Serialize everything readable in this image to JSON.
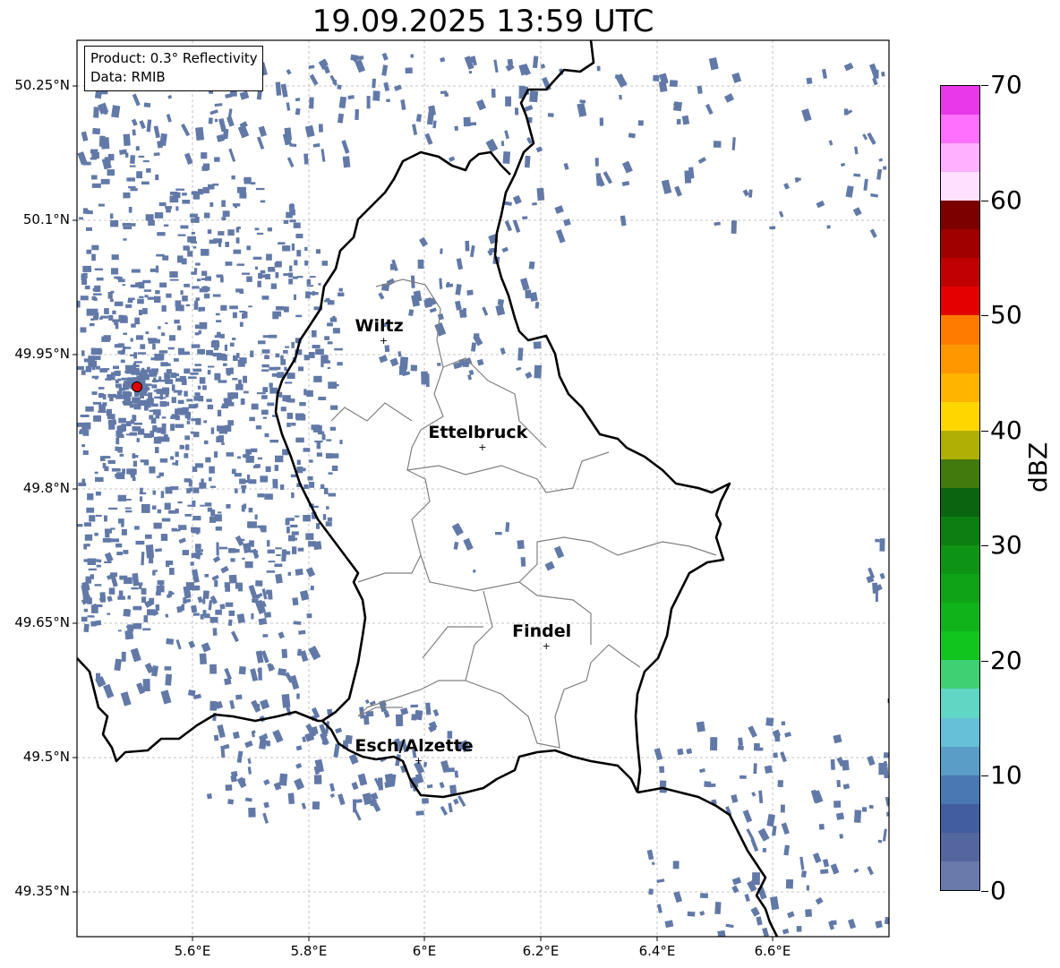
{
  "title": "19.09.2025 13:59 UTC",
  "info_box": {
    "product": "Product: 0.3° Reflectivity",
    "data": "Data: RMIB"
  },
  "latitude_labels": [
    "50.25°N",
    "50.1°N",
    "49.95°N",
    "49.8°N",
    "49.65°N",
    "49.5°N",
    "49.35°N"
  ],
  "longitude_labels": [
    "5.6°E",
    "5.8°E",
    "6°E",
    "6.2°E",
    "6.4°E",
    "6.6°E"
  ],
  "cities": [
    {
      "name": "Wiltz",
      "lon": 5.93,
      "lat": 49.966
    },
    {
      "name": "Ettelbruck",
      "lon": 6.1,
      "lat": 49.847
    },
    {
      "name": "Findel",
      "lon": 6.21,
      "lat": 49.625
    },
    {
      "name": "Esch/Alzette",
      "lon": 5.99,
      "lat": 49.497
    }
  ],
  "radar_site": {
    "lon": 5.505,
    "lat": 49.914,
    "color": "#e00000"
  },
  "echo_color": "#6279a8",
  "colorbar": {
    "label": "dBZ",
    "min": 0,
    "max": 70,
    "tick_labels": [
      "0",
      "10",
      "20",
      "30",
      "40",
      "50",
      "60",
      "70"
    ],
    "colors": [
      "#6a7aaa",
      "#54669e",
      "#425ea0",
      "#4a78b2",
      "#5a9dc6",
      "#66c0d8",
      "#62d6c4",
      "#3ed072",
      "#12c41e",
      "#10b41a",
      "#0fa417",
      "#0e9414",
      "#0c7e12",
      "#0a6410",
      "#427a0e",
      "#aeb006",
      "#ffd600",
      "#ffb400",
      "#ff9800",
      "#ff7c00",
      "#e40000",
      "#c00000",
      "#a00000",
      "#7c0000",
      "#ffe0ff",
      "#ffb0ff",
      "#ff70ff",
      "#e838e8"
    ]
  }
}
